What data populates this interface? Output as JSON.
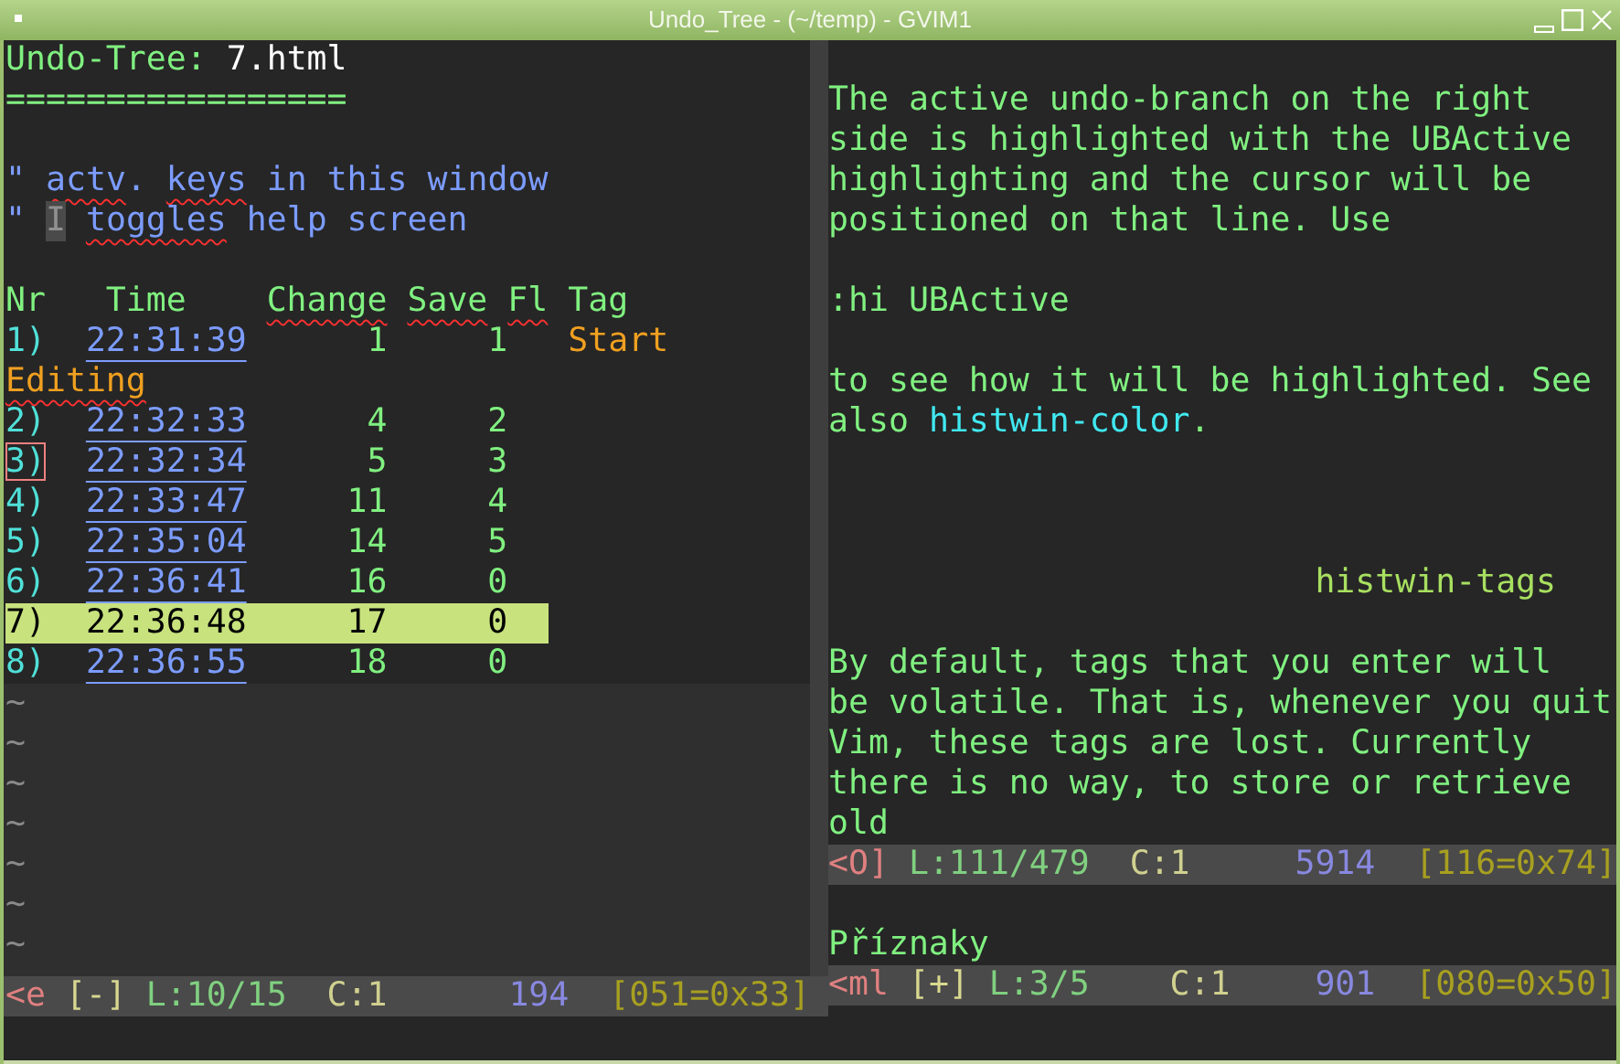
{
  "window": {
    "title": "Undo_Tree - (~/temp) - GVIM1"
  },
  "left_pane": {
    "heading_label": "Undo-Tree:",
    "heading_file": "7.html",
    "rule": "=================",
    "help_lines": [
      [
        {
          "text": "\"",
          "kind": "quote",
          "misspelled": false
        },
        {
          "text": "actv",
          "kind": "text",
          "misspelled": true
        },
        {
          "text": ".",
          "kind": "text",
          "misspelled": false
        },
        {
          "text": "keys",
          "kind": "text",
          "misspelled": true
        },
        {
          "text": "in this window",
          "kind": "text",
          "misspelled": false
        }
      ],
      [
        {
          "text": "\"",
          "kind": "quote",
          "misspelled": false
        },
        {
          "text": "I",
          "kind": "key",
          "misspelled": false
        },
        {
          "text": "toggles",
          "kind": "text",
          "misspelled": true
        },
        {
          "text": "help screen",
          "kind": "text",
          "misspelled": false
        }
      ]
    ],
    "columns": [
      {
        "label": "Nr",
        "misspelled": false
      },
      {
        "label": "Time",
        "misspelled": false
      },
      {
        "label": "Change",
        "misspelled": true
      },
      {
        "label": "Save",
        "misspelled": true
      },
      {
        "label": "Fl",
        "misspelled": true
      },
      {
        "label": "Tag",
        "misspelled": false
      }
    ],
    "rows": [
      {
        "kind": "entry",
        "nr": "1)",
        "time": "22:31:39",
        "change": "1",
        "save": "1",
        "tag": "Start",
        "selected": false,
        "cursor": false
      },
      {
        "kind": "note",
        "text": "Editing",
        "misspelled": true
      },
      {
        "kind": "entry",
        "nr": "2)",
        "time": "22:32:33",
        "change": "4",
        "save": "2",
        "selected": false,
        "cursor": false
      },
      {
        "kind": "entry",
        "nr": "3)",
        "time": "22:32:34",
        "change": "5",
        "save": "3",
        "selected": false,
        "cursor": true
      },
      {
        "kind": "entry",
        "nr": "4)",
        "time": "22:33:47",
        "change": "11",
        "save": "4",
        "selected": false,
        "cursor": false
      },
      {
        "kind": "entry",
        "nr": "5)",
        "time": "22:35:04",
        "change": "14",
        "save": "5",
        "selected": false,
        "cursor": false
      },
      {
        "kind": "entry",
        "nr": "6)",
        "time": "22:36:41",
        "change": "16",
        "save": "0",
        "selected": false,
        "cursor": false
      },
      {
        "kind": "entry",
        "nr": "7)",
        "time": "22:36:48",
        "change": "17",
        "save": "0",
        "selected": true,
        "cursor": false
      },
      {
        "kind": "entry",
        "nr": "8)",
        "time": "22:36:55",
        "change": "18",
        "save": "0",
        "selected": false,
        "cursor": false
      }
    ],
    "filler": [
      "~",
      "~",
      "~",
      "~",
      "~",
      "~",
      "~"
    ],
    "status_line": [
      {
        "text": "<e",
        "kind": "mode"
      },
      {
        "text": "[-]",
        "kind": "flag"
      },
      {
        "text": "L:10/15",
        "kind": "line"
      },
      {
        "text": "C:1",
        "kind": "column"
      },
      {
        "text": "194",
        "kind": "bytes"
      },
      {
        "text": "[051=0x33]",
        "kind": "char"
      }
    ]
  },
  "right_pane": {
    "upper": {
      "blocks": [
        {
          "kind": "paragraph",
          "lines": [
            [
              {
                "text": "The active undo-branch on the right",
                "kind": "text"
              }
            ],
            [
              {
                "text": "side is highlighted with the UBActive",
                "kind": "text"
              }
            ],
            [
              {
                "text": "highlighting and the cursor will be",
                "kind": "text"
              }
            ],
            [
              {
                "text": "positioned on that line. Use",
                "kind": "text"
              }
            ]
          ]
        },
        {
          "kind": "command",
          "text": ":hi UBActive"
        },
        {
          "kind": "paragraph",
          "lines": [
            [
              {
                "text": "to see how it will be highlighted. See",
                "kind": "text"
              }
            ],
            [
              {
                "text": "also ",
                "kind": "text"
              },
              {
                "text": "histwin-color",
                "kind": "link"
              },
              {
                "text": ".",
                "kind": "text"
              }
            ]
          ]
        },
        {
          "kind": "tag_heading",
          "text": "histwin-tags"
        },
        {
          "kind": "paragraph",
          "lines": [
            [
              {
                "text": "By default, tags that you enter will",
                "kind": "text"
              }
            ],
            [
              {
                "text": "be volatile. That is, whenever you quit",
                "kind": "text"
              }
            ],
            [
              {
                "text": "Vim, these tags are lost. Currently",
                "kind": "text"
              }
            ],
            [
              {
                "text": "there is no way, to store or retrieve",
                "kind": "text"
              }
            ],
            [
              {
                "text": "old",
                "kind": "text"
              }
            ]
          ]
        }
      ],
      "status_line": [
        {
          "text": "<O]",
          "kind": "mode"
        },
        {
          "text": "L:111/479",
          "kind": "line"
        },
        {
          "text": "C:1",
          "kind": "column"
        },
        {
          "text": "5914",
          "kind": "bytes"
        },
        {
          "text": "[116=0x74]",
          "kind": "char"
        }
      ]
    },
    "lower": {
      "lines": [
        "Příznaky"
      ],
      "status_line": [
        {
          "text": "<ml",
          "kind": "mode"
        },
        {
          "text": "[+]",
          "kind": "flag"
        },
        {
          "text": "L:3/5",
          "kind": "line"
        },
        {
          "text": "C:1",
          "kind": "column"
        },
        {
          "text": "901",
          "kind": "bytes"
        },
        {
          "text": "[080=0x50]",
          "kind": "char"
        }
      ]
    }
  }
}
